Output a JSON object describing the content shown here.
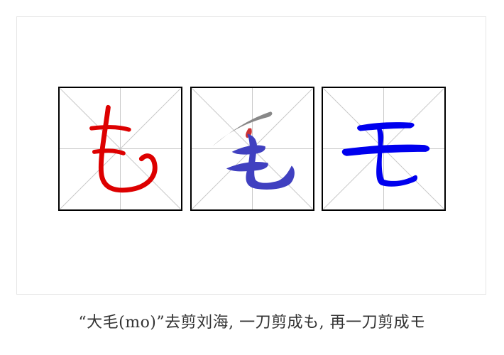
{
  "caption": "“大毛(mo)”去剪刘海, 一刀剪成も, 再一刀剪成モ",
  "panels": [
    {
      "character": "も",
      "icon": "hiragana-mo-glyph-icon",
      "color": "#dd0000"
    },
    {
      "character": "毛",
      "icon": "kanji-mao-with-cut-stroke-icon",
      "color": "#4040c0",
      "highlight_colors": {
        "cut_stroke": "#888888",
        "cut_mark": "#cc3333"
      }
    },
    {
      "character": "モ",
      "icon": "katakana-mo-glyph-icon",
      "color": "#0000ee"
    }
  ],
  "colors": {
    "grid_line": "#c8c8c8",
    "box_border": "#000000",
    "frame_border": "#e6e6e6"
  }
}
